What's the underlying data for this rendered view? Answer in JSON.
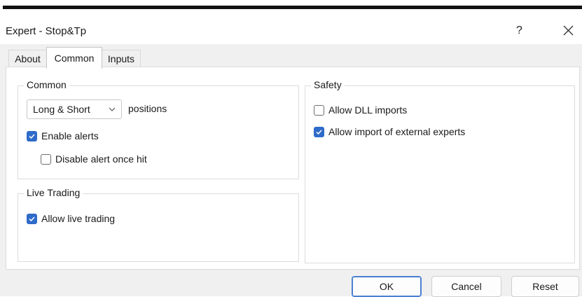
{
  "window": {
    "title": "Expert - Stop&Tp",
    "help_label": "?"
  },
  "tabs": [
    {
      "label": "About",
      "active": false
    },
    {
      "label": "Common",
      "active": true
    },
    {
      "label": "Inputs",
      "active": false
    }
  ],
  "common": {
    "group_label": "Common",
    "positions_select": {
      "value": "Long & Short"
    },
    "positions_label": "positions",
    "enable_alerts": {
      "label": "Enable alerts",
      "checked": true
    },
    "disable_alert_once_hit": {
      "label": "Disable alert once hit",
      "checked": false
    }
  },
  "live_trading": {
    "group_label": "Live Trading",
    "allow_live_trading": {
      "label": "Allow live trading",
      "checked": true
    }
  },
  "safety": {
    "group_label": "Safety",
    "allow_dll_imports": {
      "label": "Allow DLL imports",
      "checked": false
    },
    "allow_import_external": {
      "label": "Allow import of external experts",
      "checked": true
    }
  },
  "buttons": {
    "ok": "OK",
    "cancel": "Cancel",
    "reset": "Reset"
  },
  "icons": {
    "close": "close-icon",
    "checkbox": "checkmark-icon",
    "dropdown": "chevron-down-icon"
  },
  "colors": {
    "checkbox_checked": "#2f6bc9",
    "ok_border": "#4a7fd2",
    "dialog_background": "#f0f0f0"
  }
}
